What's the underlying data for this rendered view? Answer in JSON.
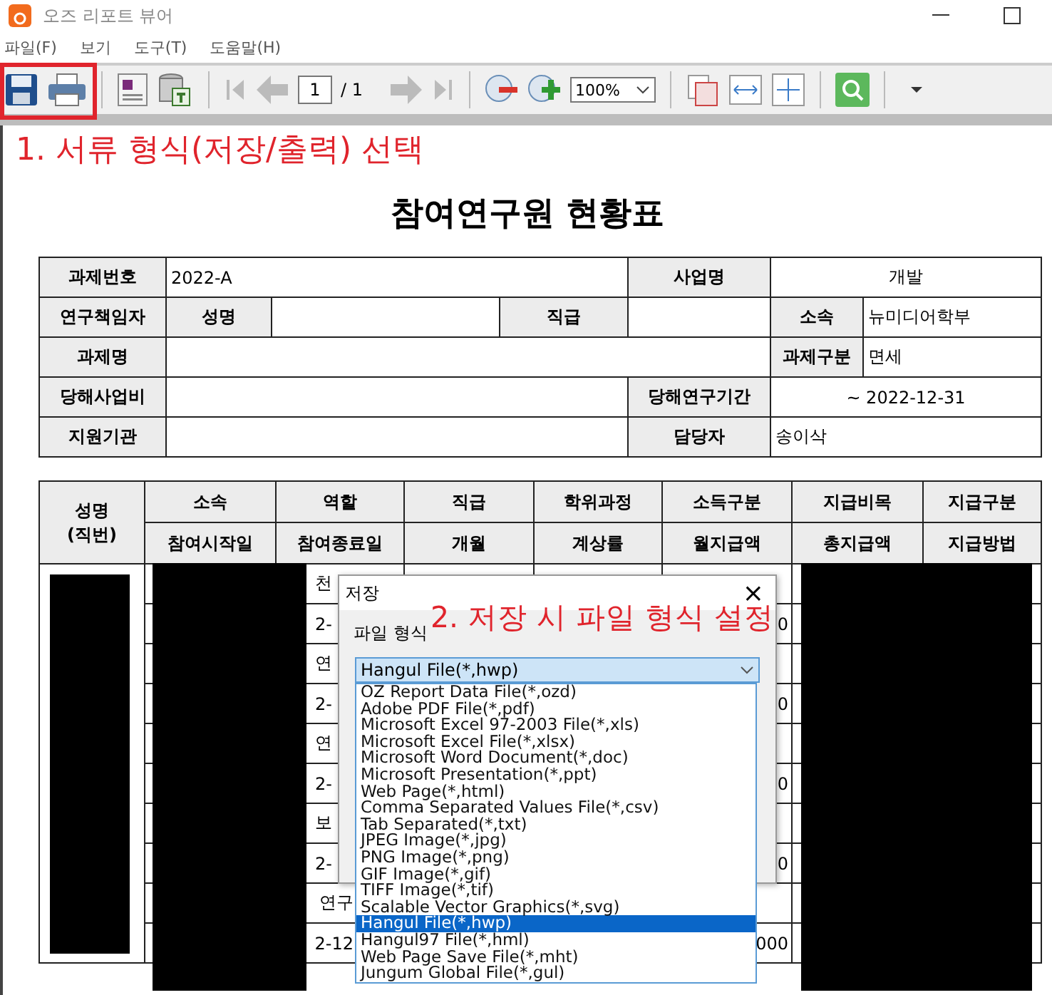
{
  "window": {
    "title": "오즈 리포트 뷰어"
  },
  "menu": [
    "파일(F)",
    "보기",
    "도구(T)",
    "도움말(H)"
  ],
  "toolbar": {
    "page": "1",
    "page_total": "/ 1",
    "zoom": "100%"
  },
  "annotations": [
    "1. 서류 형식(저장/출력) 선택",
    "2. 저장 시 파일 형식 설정"
  ],
  "report": {
    "title": "참여연구원 현황표",
    "info_table": [
      [
        {
          "kind": "label",
          "text": "과제번호"
        },
        {
          "kind": "value",
          "text": "2022-A"
        },
        {
          "kind": "label",
          "text": "사업명"
        },
        {
          "kind": "value",
          "text": "개발"
        }
      ],
      [
        {
          "kind": "label",
          "text": "연구책임자"
        },
        {
          "kind": "label",
          "text": "성명"
        },
        {
          "kind": "blank"
        },
        {
          "kind": "label",
          "text": "직급"
        },
        {
          "kind": "blank"
        },
        {
          "kind": "label",
          "text": "소속"
        },
        {
          "kind": "value",
          "text": "뉴미디어학부"
        }
      ],
      [
        {
          "kind": "label",
          "text": "과제명"
        },
        {
          "kind": "blank"
        },
        {
          "kind": "label",
          "text": "과제구분"
        },
        {
          "kind": "value",
          "text": "면세"
        }
      ],
      [
        {
          "kind": "label",
          "text": "당해사업비"
        },
        {
          "kind": "blank"
        },
        {
          "kind": "label",
          "text": "당해연구기간"
        },
        {
          "kind": "value",
          "text": "~ 2022-12-31"
        }
      ],
      [
        {
          "kind": "label",
          "text": "지원기관"
        },
        {
          "kind": "blank"
        },
        {
          "kind": "label",
          "text": "담당자"
        },
        {
          "kind": "value",
          "text": "송이삭"
        }
      ]
    ],
    "staff_table": {
      "name_header": "성명\n(직번)",
      "header_rows": [
        [
          "소속",
          "역할",
          "직급",
          "학위과정",
          "소득구분",
          "지급비목",
          "지급구분"
        ],
        [
          "참여시작일",
          "참여종료일",
          "개월",
          "계상률",
          "월지급액",
          "총지급액",
          "지급방법"
        ]
      ],
      "rows": [
        {
          "column_3": "천"
        },
        {
          "column_3": "2-",
          "column_6": "0"
        },
        {
          "column_3": "연"
        },
        {
          "column_3": "2-",
          "column_6": "0"
        },
        {
          "column_3": "연"
        },
        {
          "column_3": "2-",
          "column_6": "0"
        },
        {
          "column_3": "보"
        },
        {
          "column_3": "2-",
          "column_6": "0"
        },
        {
          "column_3": "연구"
        },
        {
          "column_3": "2-12",
          "column_6": "000"
        }
      ]
    }
  },
  "save_dialog": {
    "title": "저장",
    "close": "×",
    "format_label": "파일 형식",
    "format_value": "Hangul File(*,hwp)",
    "options": [
      {
        "label": "OZ Report Data File(*,ozd)",
        "selected": false
      },
      {
        "label": "Adobe PDF File(*,pdf)",
        "selected": false
      },
      {
        "label": "Microsoft Excel 97-2003 File(*,xls)",
        "selected": false
      },
      {
        "label": "Microsoft Excel File(*,xlsx)",
        "selected": false
      },
      {
        "label": "Microsoft Word Document(*,doc)",
        "selected": false
      },
      {
        "label": "Microsoft Presentation(*,ppt)",
        "selected": false
      },
      {
        "label": "Web Page(*,html)",
        "selected": false
      },
      {
        "label": "Comma Separated Values File(*,csv)",
        "selected": false
      },
      {
        "label": "Tab Separated(*,txt)",
        "selected": false
      },
      {
        "label": "JPEG Image(*,jpg)",
        "selected": false
      },
      {
        "label": "PNG Image(*,png)",
        "selected": false
      },
      {
        "label": "GIF Image(*,gif)",
        "selected": false
      },
      {
        "label": "TIFF Image(*,tif)",
        "selected": false
      },
      {
        "label": "Scalable Vector Graphics(*,svg)",
        "selected": false
      },
      {
        "label": "Hangul File(*,hwp)",
        "selected": true
      },
      {
        "label": "Hangul97 File(*,hml)",
        "selected": false
      },
      {
        "label": "Web Page Save File(*,mht)",
        "selected": false
      },
      {
        "label": "Jungum Global File(*,gul)",
        "selected": false
      }
    ]
  }
}
